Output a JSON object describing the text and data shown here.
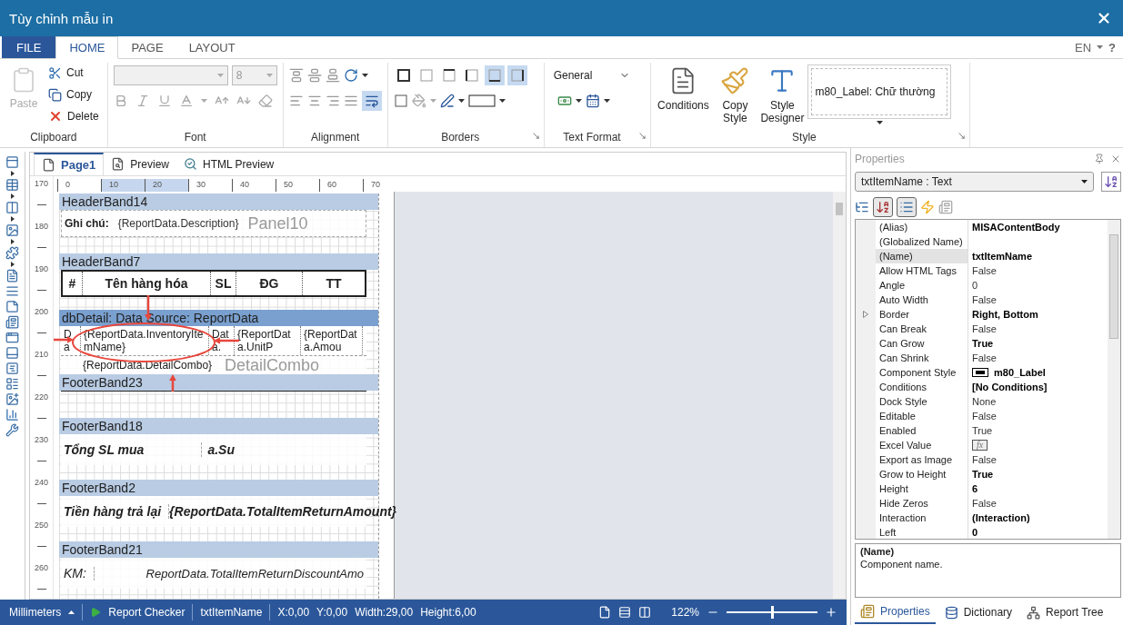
{
  "window": {
    "title": "Tùy chỉnh mẫu in"
  },
  "ribbon_tabs": [
    {
      "label": "FILE",
      "kind": "file",
      "selected": false
    },
    {
      "label": "HOME",
      "kind": "tab",
      "selected": true
    },
    {
      "label": "PAGE",
      "kind": "tab",
      "selected": false
    },
    {
      "label": "LAYOUT",
      "kind": "tab",
      "selected": false
    }
  ],
  "language": "EN",
  "help": "?",
  "clipboard": {
    "title": "Clipboard",
    "paste": {
      "label": "Paste",
      "disabled": true
    },
    "items": [
      {
        "label": "Cut",
        "kind": "cut"
      },
      {
        "label": "Copy",
        "kind": "copy"
      },
      {
        "label": "Delete",
        "kind": "delete"
      }
    ]
  },
  "font": {
    "title": "Font",
    "font_size": "8",
    "disabled": true
  },
  "alignment": {
    "title": "Alignment",
    "word_wrap": true
  },
  "borders": {
    "title": "Borders",
    "buttons": [
      {
        "kind": "all",
        "selected": false
      },
      {
        "kind": "none",
        "selected": false
      },
      {
        "kind": "top",
        "selected": false
      },
      {
        "kind": "left",
        "selected": false
      },
      {
        "kind": "bottom",
        "selected": true
      },
      {
        "kind": "right",
        "selected": true
      }
    ]
  },
  "text_format": {
    "title": "Text Format",
    "format": "General"
  },
  "style": {
    "title": "Style",
    "current_style": "m80_Label: Chữ thường",
    "buttons": [
      {
        "label": "Conditions",
        "kind": "conditions"
      },
      {
        "label": "Copy Style",
        "kind": "copy_style"
      },
      {
        "label": "Style Designer",
        "kind": "designer"
      }
    ]
  },
  "designer_tabs": [
    {
      "label": "Page1",
      "kind": "page",
      "selected": true
    },
    {
      "label": "Preview",
      "kind": "preview",
      "selected": false
    },
    {
      "label": "HTML Preview",
      "kind": "html",
      "selected": false
    }
  ],
  "ruler_h": [
    {
      "label": "0",
      "highlighted": false
    },
    {
      "label": "10",
      "highlighted": true
    },
    {
      "label": "20",
      "highlighted": true
    },
    {
      "label": "30",
      "highlighted": false
    },
    {
      "label": "40",
      "highlighted": false
    },
    {
      "label": "50",
      "highlighted": false
    },
    {
      "label": "60",
      "highlighted": false
    },
    {
      "label": "70",
      "highlighted": false
    }
  ],
  "ruler_v": [
    "170",
    "180",
    "190",
    "200",
    "210",
    "220",
    "230",
    "240",
    "250",
    "260"
  ],
  "bands": [
    {
      "kind": "note",
      "title": "HeaderBand14",
      "selected": false,
      "label": "Ghi chú:",
      "value": "{ReportData.Description}",
      "ghost": "Panel10"
    },
    {
      "kind": "table_header",
      "title": "HeaderBand7",
      "selected": false,
      "columns": [
        "#",
        "Tên hàng hóa",
        "SL",
        "ĐG",
        "TT"
      ]
    },
    {
      "kind": "detail",
      "title": "dbDetail: Data Source: ReportData",
      "selected": true,
      "cells": [
        "Da",
        "{ReportData.InventoryItemName}",
        "Data.",
        "{ReportData.UnitP",
        "{ReportData.Amou"
      ],
      "combo": "{ReportData.DetailCombo}",
      "ghost": "DetailCombo"
    },
    {
      "kind": "empty",
      "title": "FooterBand23",
      "selected": false
    },
    {
      "kind": "total_short",
      "title": "FooterBand18",
      "selected": false,
      "bold": true,
      "label": "Tổng SL mua",
      "value": "a.Su"
    },
    {
      "kind": "total",
      "title": "FooterBand2",
      "selected": false,
      "bold": true,
      "label": "Tiền hàng trả lại",
      "value": "{ReportData.TotalItemReturnAmount}"
    },
    {
      "kind": "total",
      "title": "FooterBand21",
      "selected": false,
      "bold": false,
      "label": "KM:",
      "value": "ReportData.TotalItemReturnDiscountAmo"
    }
  ],
  "properties": {
    "title": "Properties",
    "object": "txtItemName : Text",
    "rows": [
      {
        "name": "(Alias)",
        "value": "MISAContentBody",
        "bold": true,
        "selected": false,
        "kind": "text"
      },
      {
        "name": "(Globalized Name)",
        "selected": false,
        "kind": "text"
      },
      {
        "name": "(Name)",
        "value": "txtItemName",
        "bold": true,
        "selected": true,
        "kind": "text"
      },
      {
        "name": "Allow HTML Tags",
        "value": "False",
        "bold": false,
        "selected": false,
        "kind": "text"
      },
      {
        "name": "Angle",
        "value": "0",
        "bold": false,
        "selected": false,
        "kind": "text"
      },
      {
        "name": "Auto Width",
        "value": "False",
        "bold": false,
        "selected": false,
        "kind": "text"
      },
      {
        "name": "Border",
        "value": "Right, Bottom",
        "bold": true,
        "selected": false,
        "kind": "expandable"
      },
      {
        "name": "Can Break",
        "value": "False",
        "bold": false,
        "selected": false,
        "kind": "text"
      },
      {
        "name": "Can Grow",
        "value": "True",
        "bold": true,
        "selected": false,
        "kind": "text"
      },
      {
        "name": "Can Shrink",
        "value": "False",
        "bold": false,
        "selected": false,
        "kind": "text"
      },
      {
        "name": "Component Style",
        "value": "m80_Label",
        "bold": true,
        "selected": false,
        "kind": "style"
      },
      {
        "name": "Conditions",
        "value": "[No Conditions]",
        "bold": true,
        "selected": false,
        "kind": "text"
      },
      {
        "name": "Dock Style",
        "value": "None",
        "bold": false,
        "selected": false,
        "kind": "text"
      },
      {
        "name": "Editable",
        "value": "False",
        "bold": false,
        "selected": false,
        "kind": "text"
      },
      {
        "name": "Enabled",
        "value": "True",
        "bold": false,
        "selected": false,
        "kind": "text"
      },
      {
        "name": "Excel Value",
        "value": "fx",
        "selected": false,
        "kind": "formula"
      },
      {
        "name": "Export as Image",
        "value": "False",
        "bold": false,
        "selected": false,
        "kind": "text"
      },
      {
        "name": "Grow to Height",
        "value": "True",
        "bold": true,
        "selected": false,
        "kind": "text"
      },
      {
        "name": "Height",
        "value": "6",
        "bold": true,
        "selected": false,
        "kind": "text"
      },
      {
        "name": "Hide Zeros",
        "value": "False",
        "bold": false,
        "selected": false,
        "kind": "text"
      },
      {
        "name": "Interaction",
        "value": "(Interaction)",
        "bold": true,
        "selected": false,
        "kind": "text"
      },
      {
        "name": "Left",
        "value": "0",
        "bold": true,
        "selected": false,
        "kind": "text"
      }
    ],
    "description": {
      "title": "(Name)",
      "text": "Component name."
    },
    "tabs": [
      {
        "label": "Properties",
        "kind": "properties",
        "selected": true
      },
      {
        "label": "Dictionary",
        "kind": "dictionary",
        "selected": false
      },
      {
        "label": "Report Tree",
        "kind": "tree",
        "selected": false
      }
    ]
  },
  "status": {
    "unit": "Millimeters",
    "checker": "Report Checker",
    "component": "txtItemName",
    "x": "X:0,00",
    "y": "Y:0,00",
    "width": "Width:29,00",
    "height": "Height:6,00",
    "zoom": "122%",
    "zoom_slider": {
      "level": 0.5
    }
  }
}
